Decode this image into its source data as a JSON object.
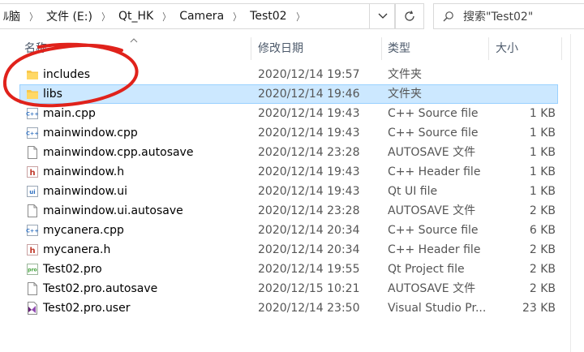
{
  "breadcrumb": {
    "items": [
      "ﾙ脑",
      "文件 (E:)",
      "Qt_HK",
      "Camera",
      "Test02"
    ],
    "separator": "〉"
  },
  "search": {
    "placeholder": "搜索\"Test02\""
  },
  "columns": {
    "name": "名称",
    "date": "修改日期",
    "type": "类型",
    "size": "大小"
  },
  "files": [
    {
      "name": "includes",
      "date": "2020/12/14 19:57",
      "type": "文件夹",
      "size": "",
      "icon": "folder-icon",
      "selected": false
    },
    {
      "name": "libs",
      "date": "2020/12/14 19:46",
      "type": "文件夹",
      "size": "",
      "icon": "folder-icon",
      "selected": true
    },
    {
      "name": "main.cpp",
      "date": "2020/12/14 19:43",
      "type": "C++ Source file",
      "size": "1 KB",
      "icon": "cpp-file-icon",
      "selected": false
    },
    {
      "name": "mainwindow.cpp",
      "date": "2020/12/14 19:43",
      "type": "C++ Source file",
      "size": "1 KB",
      "icon": "cpp-file-icon",
      "selected": false
    },
    {
      "name": "mainwindow.cpp.autosave",
      "date": "2020/12/14 23:28",
      "type": "AUTOSAVE 文件",
      "size": "1 KB",
      "icon": "blank-file-icon",
      "selected": false
    },
    {
      "name": "mainwindow.h",
      "date": "2020/12/14 19:43",
      "type": "C++ Header file",
      "size": "1 KB",
      "icon": "header-file-icon",
      "selected": false
    },
    {
      "name": "mainwindow.ui",
      "date": "2020/12/14 19:43",
      "type": "Qt UI file",
      "size": "1 KB",
      "icon": "ui-file-icon",
      "selected": false
    },
    {
      "name": "mainwindow.ui.autosave",
      "date": "2020/12/14 23:28",
      "type": "AUTOSAVE 文件",
      "size": "2 KB",
      "icon": "blank-file-icon",
      "selected": false
    },
    {
      "name": "mycanera.cpp",
      "date": "2020/12/14 20:34",
      "type": "C++ Source file",
      "size": "6 KB",
      "icon": "cpp-file-icon",
      "selected": false
    },
    {
      "name": "mycanera.h",
      "date": "2020/12/14 20:34",
      "type": "C++ Header file",
      "size": "2 KB",
      "icon": "header-file-icon",
      "selected": false
    },
    {
      "name": "Test02.pro",
      "date": "2020/12/14 19:55",
      "type": "Qt Project file",
      "size": "2 KB",
      "icon": "pro-file-icon",
      "selected": false
    },
    {
      "name": "Test02.pro.autosave",
      "date": "2020/12/15 10:21",
      "type": "AUTOSAVE 文件",
      "size": "2 KB",
      "icon": "blank-file-icon",
      "selected": false
    },
    {
      "name": "Test02.pro.user",
      "date": "2020/12/14 23:50",
      "type": "Visual Studio Pr...",
      "size": "23 KB",
      "icon": "visual-studio-icon",
      "selected": false
    }
  ],
  "colors": {
    "selection_fill": "#cce8ff",
    "selection_border": "#99d1ff",
    "folder": "#f8c74c",
    "annotation": "#e0221b"
  }
}
